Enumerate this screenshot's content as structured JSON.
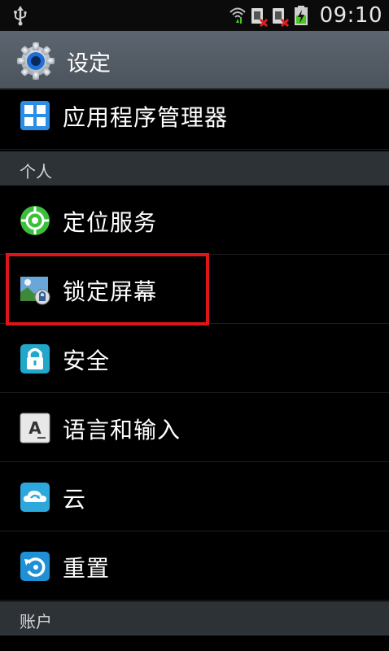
{
  "status_bar": {
    "time": "09:10"
  },
  "app_bar": {
    "title": "设定",
    "icon": "gear-icon"
  },
  "items": [
    {
      "label": "应用程序管理器",
      "icon": "app-grid-icon"
    },
    {
      "label": "定位服务",
      "icon": "location-target-icon"
    },
    {
      "label": "锁定屏幕",
      "icon": "lock-screen-icon"
    },
    {
      "label": "安全",
      "icon": "padlock-icon"
    },
    {
      "label": "语言和输入",
      "icon": "keyboard-a-icon"
    },
    {
      "label": "云",
      "icon": "cloud-sync-icon"
    },
    {
      "label": "重置",
      "icon": "reset-icon"
    }
  ],
  "sections": {
    "personal": "个人",
    "accounts": "账户"
  },
  "colors": {
    "highlight": "#e0141a",
    "header_bg": "#2d3236",
    "actionbar": "#55606a"
  }
}
